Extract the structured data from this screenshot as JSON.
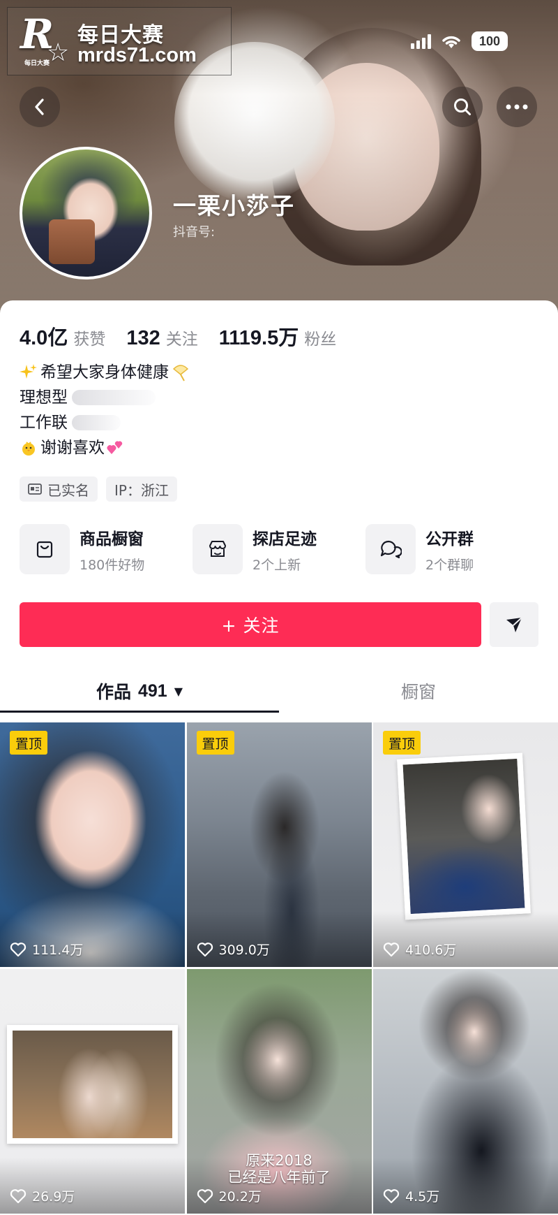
{
  "watermark": {
    "logo_letter": "R",
    "logo_small": "每日大赛",
    "title": "每日大赛",
    "url": "mrds71.com"
  },
  "status_bar": {
    "battery": "100"
  },
  "header": {
    "nickname": "一栗小莎子",
    "douyin_id_label": "抖音号:"
  },
  "stats": [
    {
      "value": "4.0亿",
      "label": "获赞"
    },
    {
      "value": "132",
      "label": "关注"
    },
    {
      "value": "1119.5万",
      "label": "粉丝"
    }
  ],
  "bio": {
    "line1": "希望大家身体健康",
    "line2": "理想型",
    "line3": "工作联",
    "line4": "谢谢喜欢"
  },
  "tags": {
    "verified": "已实名",
    "ip": "IP：浙江"
  },
  "features": [
    {
      "title": "商品橱窗",
      "sub": "180件好物"
    },
    {
      "title": "探店足迹",
      "sub": "2个上新"
    },
    {
      "title": "公开群",
      "sub": "2个群聊"
    }
  ],
  "actions": {
    "follow_label": "+ 关注"
  },
  "tabs": {
    "works_label": "作品",
    "works_count": "491",
    "showcase_label": "橱窗"
  },
  "videos": [
    {
      "pinned": true,
      "pin_label": "置顶",
      "likes": "111.4万"
    },
    {
      "pinned": true,
      "pin_label": "置顶",
      "likes": "309.0万"
    },
    {
      "pinned": true,
      "pin_label": "置顶",
      "likes": "410.6万"
    },
    {
      "pinned": false,
      "likes": "26.9万"
    },
    {
      "pinned": false,
      "likes": "20.2万",
      "caption_line1": "原来2018",
      "caption_line2": "已经是八年前了"
    },
    {
      "pinned": false,
      "likes": "4.5万"
    }
  ],
  "colors": {
    "accent": "#fe2c55",
    "pin": "#facd0b",
    "text_primary": "#161823",
    "text_secondary": "#8a8b91"
  }
}
